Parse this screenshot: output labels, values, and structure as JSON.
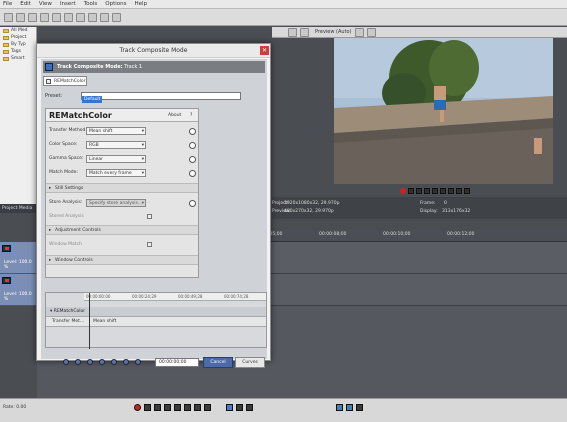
{
  "menu": [
    "File",
    "Edit",
    "View",
    "Insert",
    "Tools",
    "Options",
    "Help"
  ],
  "tree": [
    "All Med",
    "Project",
    "By Typ",
    "Tags",
    "Smart"
  ],
  "project_media_title": "Project Media",
  "tracks": [
    {
      "level": "Level: 100.0 %"
    },
    {
      "level": "Level: 100.0 %"
    }
  ],
  "preview": {
    "quality": "Preview (Auto)"
  },
  "info": {
    "project": "Project:",
    "project_value": "1920x1080x32, 29.970p",
    "preview": "Preview:",
    "preview_value": "480x270x32, 29.970p",
    "frame": "Frame:",
    "frame_value": "0",
    "display": "Display:",
    "display_value": "313x176x32"
  },
  "ruler": [
    "00:00:05;00",
    "00:00:08;00",
    "00:00:10;00",
    "00:00:12;00"
  ],
  "bottom": {
    "rate": "Rate: 0.00"
  },
  "dialog": {
    "title": "Track Composite Mode",
    "header_label": "Track Composite Mode:",
    "header_track": "Track 1",
    "fx_tab": "REMatchColor",
    "preset_label": "Preset:",
    "preset_value": "Default",
    "plugin_name": "REMatchColor",
    "about": "About",
    "help": "?",
    "params": [
      {
        "label": "Transfer Method:",
        "value": "Mean shift"
      },
      {
        "label": "Color Space:",
        "value": "RGB"
      },
      {
        "label": "Gamma Space:",
        "value": "Linear"
      },
      {
        "label": "Match Mode:",
        "value": "Match every frame"
      }
    ],
    "section_still": "Still Settings",
    "store_label": "Store Analysis:",
    "store_value": "Specify store analysis...",
    "stored_label": "Stored Analysis",
    "section_adjust": "Adjustment Controls",
    "window_match": "Window Match",
    "section_window": "Window Controls",
    "kf_ruler": [
      "00:00:00:00",
      "00:00:24;29",
      "00:00:49;28",
      "00:00:74;28"
    ],
    "kf_group": "REMatchColor",
    "kf_param": "Transfer Met...",
    "kf_value": "Mean shift",
    "timecode": "00:00:00;00",
    "ok": "Cancel",
    "cancel": "Curves"
  }
}
